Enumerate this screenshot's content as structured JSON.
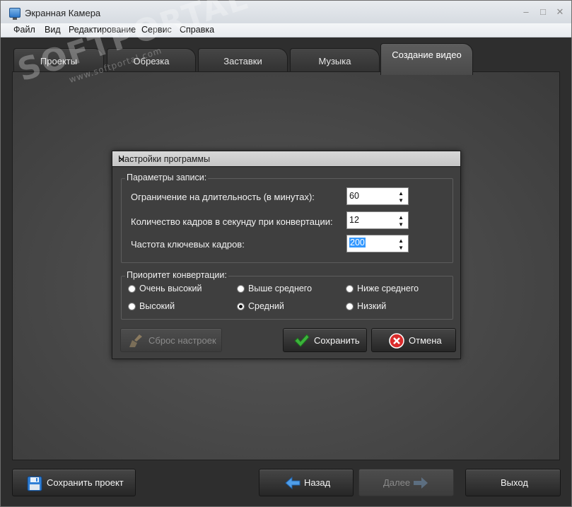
{
  "window": {
    "title": "Экранная Камера"
  },
  "menu": [
    "Файл",
    "Вид",
    "Редактирование",
    "Сервис",
    "Справка"
  ],
  "tabs": [
    {
      "label": "Проекты"
    },
    {
      "label": "Обрезка"
    },
    {
      "label": "Заставки"
    },
    {
      "label": "Музыка"
    },
    {
      "label": "Создание видео",
      "active": true
    }
  ],
  "watermark": {
    "text": "SOFTPORTAL",
    "url": "www.softportal.com",
    "tm": "TM"
  },
  "dialog": {
    "title": "Настройки программы",
    "close": "✕",
    "recording": {
      "legend": "Параметры записи:",
      "duration_label": "Ограничение на длительность (в минутах):",
      "duration_value": "60",
      "fps_label": "Количество кадров в секунду при конвертации:",
      "fps_value": "12",
      "keyframe_label": "Частота ключевых кадров:",
      "keyframe_value": "200"
    },
    "priority": {
      "legend": "Приоритет конвертации:",
      "options": [
        "Очень высокий",
        "Выше среднего",
        "Ниже среднего",
        "Высокий",
        "Средний",
        "Низкий"
      ],
      "selected": "Средний"
    },
    "reset_label": "Сброс настроек",
    "save_label": "Сохранить",
    "cancel_label": "Отмена"
  },
  "bottom": {
    "save_project_label": "Сохранить проект",
    "back_label": "Назад",
    "next_label": "Далее",
    "exit_label": "Выход"
  },
  "colors": {
    "accent_selection": "#3398ff",
    "ok_green": "#3bb33b",
    "cancel_red": "#d92b2b",
    "arrow_blue": "#4f9de8"
  }
}
